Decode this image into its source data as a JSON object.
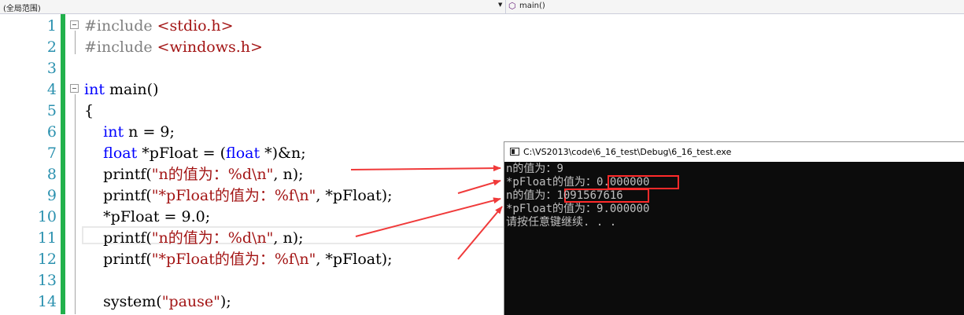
{
  "navbar": {
    "scope_label": "(全局范围)",
    "member_label": "main()",
    "member_icon": "method-icon"
  },
  "editor": {
    "line_numbers": [
      "1",
      "2",
      "3",
      "4",
      "5",
      "6",
      "7",
      "8",
      "9",
      "10",
      "11",
      "12",
      "13",
      "14"
    ],
    "lines": [
      [
        {
          "t": "#include ",
          "c": "pp"
        },
        {
          "t": "<stdio.h>",
          "c": "inc"
        }
      ],
      [
        {
          "t": "#include ",
          "c": "pp"
        },
        {
          "t": "<windows.h>",
          "c": "inc"
        }
      ],
      [],
      [
        {
          "t": "int",
          "c": "kw"
        },
        {
          "t": " main()",
          "c": ""
        }
      ],
      [
        {
          "t": "{",
          "c": ""
        }
      ],
      [
        {
          "t": "    ",
          "c": ""
        },
        {
          "t": "int",
          "c": "kw"
        },
        {
          "t": " n = 9;",
          "c": ""
        }
      ],
      [
        {
          "t": "    ",
          "c": ""
        },
        {
          "t": "float",
          "c": "kw"
        },
        {
          "t": " *pFloat = (",
          "c": ""
        },
        {
          "t": "float",
          "c": "kw"
        },
        {
          "t": " *)&n;",
          "c": ""
        }
      ],
      [
        {
          "t": "    printf(",
          "c": ""
        },
        {
          "t": "\"n的值为：%d\\n\"",
          "c": "str"
        },
        {
          "t": ", n);",
          "c": ""
        }
      ],
      [
        {
          "t": "    printf(",
          "c": ""
        },
        {
          "t": "\"*pFloat的值为：%f\\n\"",
          "c": "str"
        },
        {
          "t": ", *pFloat);",
          "c": ""
        }
      ],
      [
        {
          "t": "    *pFloat = 9.0;",
          "c": ""
        }
      ],
      [
        {
          "t": "    printf(",
          "c": ""
        },
        {
          "t": "\"n的值为：%d\\n\"",
          "c": "str"
        },
        {
          "t": ", n);",
          "c": ""
        }
      ],
      [
        {
          "t": "    printf(",
          "c": ""
        },
        {
          "t": "\"*pFloat的值为：%f\\n\"",
          "c": "str"
        },
        {
          "t": ", *pFloat);",
          "c": ""
        }
      ],
      [],
      [
        {
          "t": "    system(",
          "c": ""
        },
        {
          "t": "\"pause\"",
          "c": "str"
        },
        {
          "t": ");",
          "c": ""
        }
      ]
    ],
    "colors": {
      "keyword": "#0000ff",
      "preprocessor": "#808080",
      "string": "#a31515",
      "line_number": "#2b91af",
      "change_bar": "#22b14c"
    }
  },
  "console": {
    "title": "C:\\VS2013\\code\\6_16_test\\Debug\\6_16_test.exe",
    "icon": "console-window-icon",
    "lines": [
      {
        "label": "n的值为：",
        "value": "9"
      },
      {
        "label": "*pFloat的值为：",
        "value": "0.000000"
      },
      {
        "label": "n的值为：",
        "value": "1091567616"
      },
      {
        "label": "*pFloat的值为：",
        "value": "9.000000"
      },
      {
        "label": "请按任意键继续. . .",
        "value": ""
      }
    ],
    "highlight_color": "#ff2a2a"
  }
}
